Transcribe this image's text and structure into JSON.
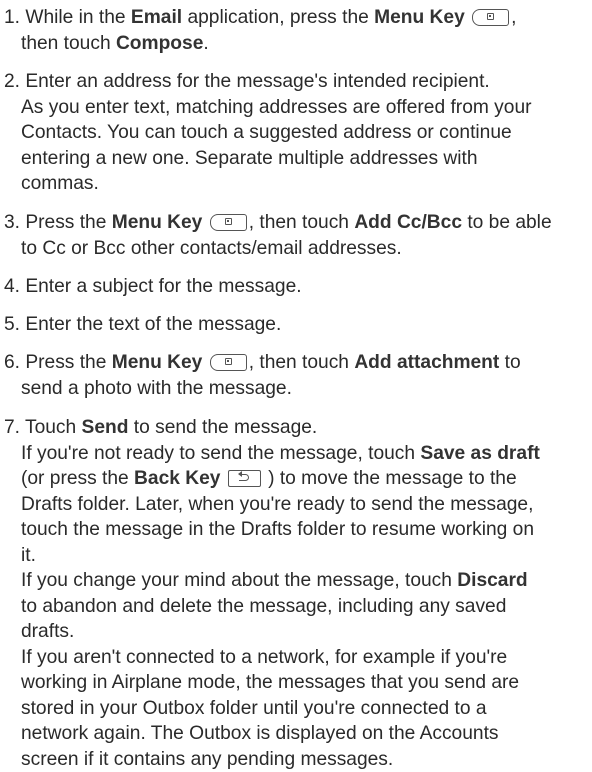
{
  "steps": [
    {
      "lines": [
        [
          "1. While in the ",
          {
            "b": "Email"
          },
          " application, press the ",
          {
            "b": "Menu Key"
          },
          " ",
          {
            "key": "menu"
          },
          ","
        ],
        [
          "then touch ",
          {
            "b": "Compose"
          },
          "."
        ]
      ]
    },
    {
      "lines": [
        [
          "2. Enter an address for the message's intended recipient."
        ],
        [
          "As you enter text, matching addresses are offered from your"
        ],
        [
          "Contacts. You can touch a suggested address or continue"
        ],
        [
          "entering a new one. Separate multiple addresses with"
        ],
        [
          "commas."
        ]
      ]
    },
    {
      "lines": [
        [
          "3. Press the ",
          {
            "b": "Menu Key"
          },
          " ",
          {
            "key": "menu"
          },
          ", then touch ",
          {
            "b": "Add Cc/Bcc"
          },
          " to be able"
        ],
        [
          "to Cc or Bcc other contacts/email addresses."
        ]
      ]
    },
    {
      "lines": [
        [
          "4. Enter a subject for the message."
        ]
      ]
    },
    {
      "lines": [
        [
          "5. Enter the text of the message."
        ]
      ]
    },
    {
      "lines": [
        [
          "6. Press the ",
          {
            "b": "Menu Key"
          },
          " ",
          {
            "key": "menu"
          },
          ", then touch ",
          {
            "b": "Add attachment"
          },
          " to"
        ],
        [
          "send a photo with the message."
        ]
      ]
    },
    {
      "lines": [
        [
          "7. Touch ",
          {
            "b": "Send"
          },
          " to send the message."
        ],
        [
          "If you're not ready to send the message, touch ",
          {
            "b": "Save as draft"
          }
        ],
        [
          "(or press the ",
          {
            "b": "Back Key"
          },
          " ",
          {
            "key": "back"
          },
          " ) to move the message to the"
        ],
        [
          "Drafts folder. Later, when you're ready to send the message,"
        ],
        [
          "touch the message in the Drafts folder to resume working on"
        ],
        [
          "it."
        ],
        [
          "If you change your mind about the message, touch ",
          {
            "b": "Discard"
          }
        ],
        [
          "to abandon and delete the message, including any saved"
        ],
        [
          "drafts."
        ],
        [
          "If you aren't connected to a network, for example if you're"
        ],
        [
          "working in Airplane mode, the messages that you send are"
        ],
        [
          "stored in your Outbox folder until you're connected to a"
        ],
        [
          "network again. The Outbox is displayed on the Accounts"
        ],
        [
          "screen if it contains any pending messages."
        ]
      ]
    }
  ]
}
